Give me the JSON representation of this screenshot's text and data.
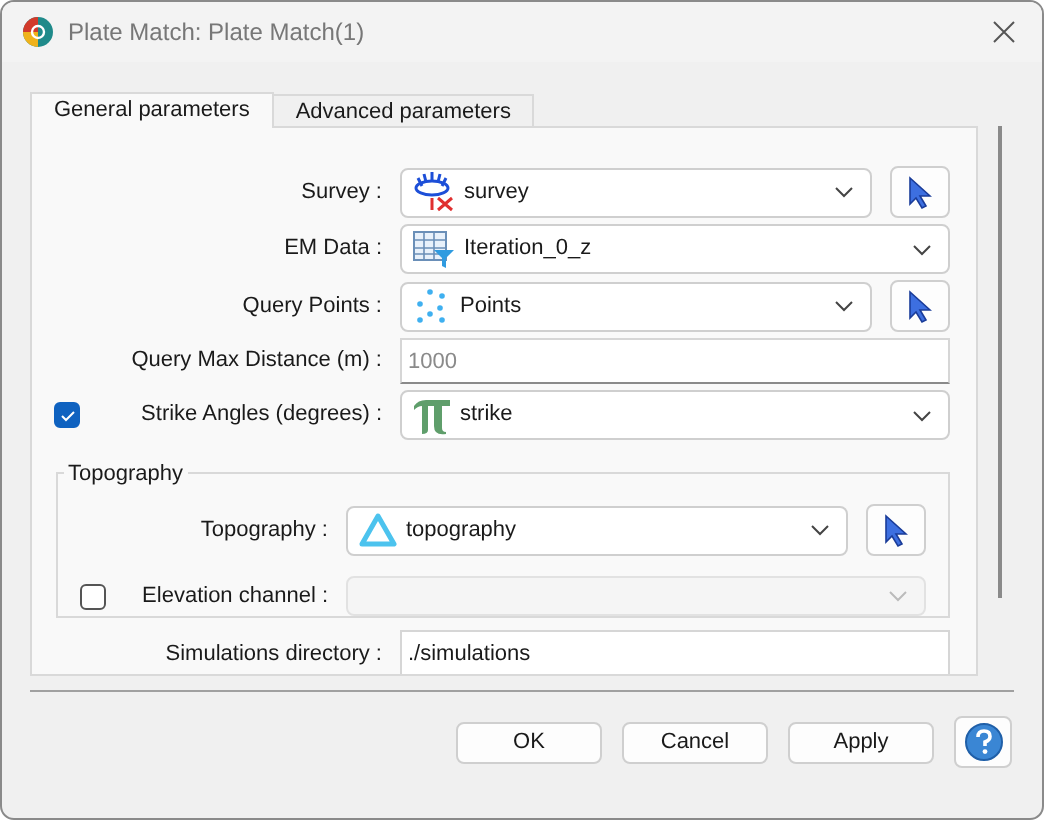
{
  "window": {
    "title": "Plate Match: Plate Match(1)"
  },
  "tabs": [
    {
      "label": "General parameters",
      "selected": true
    },
    {
      "label": "Advanced parameters",
      "selected": false
    }
  ],
  "fields": [
    {
      "kind": "combo",
      "label": "Survey :",
      "value": "survey"
    },
    {
      "kind": "combo",
      "label": "EM Data :",
      "value": "Iteration_0_z"
    },
    {
      "kind": "combo",
      "label": "Query Points :",
      "value": "Points"
    },
    {
      "kind": "text",
      "label": "Query Max Distance (m) :",
      "placeholder": "1000"
    },
    {
      "kind": "combo",
      "label": "Strike Angles (degrees) :",
      "value": "strike",
      "checked": true
    }
  ],
  "topography": {
    "title": "Topography",
    "fields": [
      {
        "kind": "combo",
        "label": "Topography :",
        "value": "topography"
      },
      {
        "kind": "combo",
        "label": "Elevation channel :",
        "checked": false,
        "disabled": true
      }
    ]
  },
  "simulations": {
    "label": "Simulations directory :",
    "value": "./simulations"
  },
  "buttons": [
    "OK",
    "Cancel",
    "Apply"
  ]
}
